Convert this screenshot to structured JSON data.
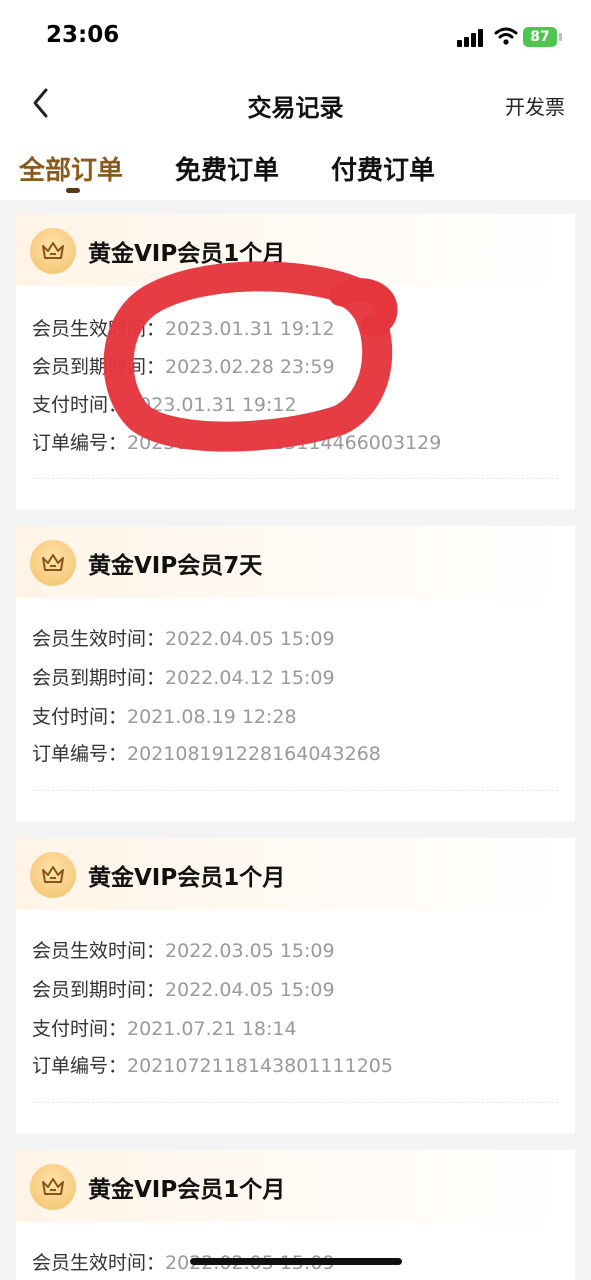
{
  "status_bar": {
    "time": "23:06",
    "battery": "87"
  },
  "nav": {
    "title": "交易记录",
    "right_action": "开发票"
  },
  "tabs": [
    {
      "label": "全部订单",
      "active": true
    },
    {
      "label": "免费订单",
      "active": false
    },
    {
      "label": "付费订单",
      "active": false
    }
  ],
  "labels": {
    "start": "会员生效时间：",
    "end": "会员到期时间：",
    "pay": "支付时间：",
    "order": "订单编号："
  },
  "orders": [
    {
      "title": "黄金VIP会员1个月",
      "start": "2023.01.31 19:12",
      "end": "2023.02.28 23:59",
      "pay": "2023.01.31 19:12",
      "order_no": "20230131191215114466003129"
    },
    {
      "title": "黄金VIP会员7天",
      "start": "2022.04.05 15:09",
      "end": "2022.04.12 15:09",
      "pay": "2021.08.19 12:28",
      "order_no": "20210819122816404326​8"
    },
    {
      "title": "黄金VIP会员1个月",
      "start": "2022.03.05 15:09",
      "end": "2022.04.05 15:09",
      "pay": "2021.07.21 18:14",
      "order_no": "20210721181438011112​05"
    },
    {
      "title": "黄金VIP会员1个月",
      "start": "2022.02.05 15:09"
    }
  ],
  "colors": {
    "active_tab": "#8a5a1a",
    "annotation_red": "#e5363d",
    "battery_green": "#4cc64e"
  },
  "icons": {
    "back": "chevron-left-icon",
    "crown": "crown-icon",
    "signal": "signal-icon",
    "wifi": "wifi-icon",
    "battery": "battery-icon"
  }
}
